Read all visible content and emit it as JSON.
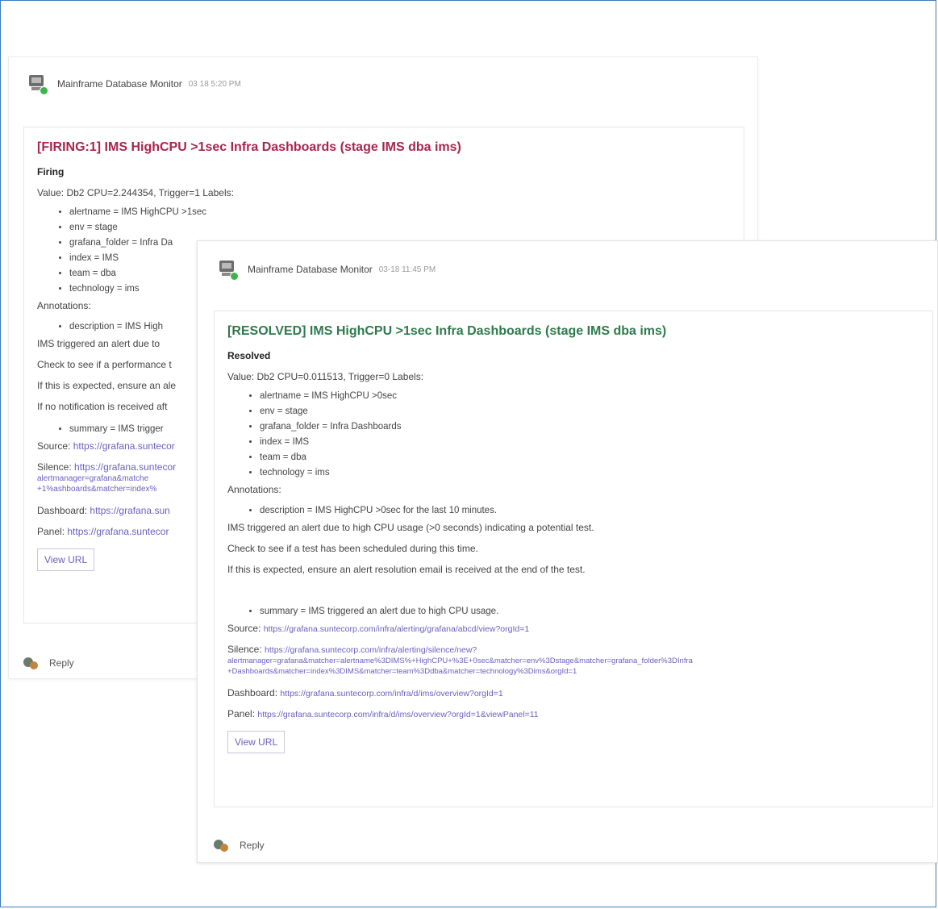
{
  "back_card": {
    "sender": "Mainframe Database Monitor",
    "time": "03 18 5:20 PM",
    "title": "[FIRING:1] IMS HighCPU >1sec Infra Dashboards (stage IMS dba ims)",
    "status": "Firing",
    "value_line": "Value: Db2 CPU=2.244354, Trigger=1 Labels:",
    "labels": [
      "alertname = IMS   HighCPU >1sec",
      "env = stage",
      "grafana_folder = Infra Da",
      "index = IMS",
      "team = dba",
      "technology = ims"
    ],
    "annotations_label": "Annotations:",
    "description": "description = IMS   High",
    "ims_line": "IMS   triggered an alert due to",
    "check_line": "Check to see if a performance t",
    "expected_line": "If this is expected, ensure an ale",
    "notification_line": "If no notification is received aft",
    "summary": "summary = IMS   trigger",
    "source_label": "Source:",
    "source_link": "https://grafana.suntecor",
    "silence_label": "Silence:",
    "silence_link_1": "https://grafana.suntecor",
    "silence_link_2": "alertmanager=grafana&matche",
    "silence_link_3": "+1%ashboards&matcher=index%",
    "dashboard_label": "Dashboard:",
    "dashboard_link": "https://grafana.sun",
    "panel_label": "Panel:",
    "panel_link": "https://grafana.suntecor",
    "view_url": "View URL",
    "reply": "Reply"
  },
  "front_card": {
    "sender": "Mainframe Database Monitor",
    "time": "03-18 11:45 PM",
    "title": "[RESOLVED] IMS HighCPU >1sec Infra Dashboards (stage IMS dba ims)",
    "status": "Resolved",
    "value_line": "Value: Db2 CPU=0.011513, Trigger=0 Labels:",
    "labels": [
      "alertname = IMS   HighCPU >0sec",
      "env = stage",
      "grafana_folder = Infra Dashboards",
      "index = IMS",
      "team = dba",
      "technology = ims"
    ],
    "annotations_label": "Annotations:",
    "description": "description = IMS   HighCPU >0sec for the last 10 minutes.",
    "ims_line": "IMS   triggered an alert due to high CPU usage (>0 seconds) indicating a potential test.",
    "check_line": "Check to see if a test has been scheduled during this time.",
    "expected_line": "If this is expected, ensure an alert resolution email is received at the end of the test.",
    "summary": "summary = IMS   triggered an alert due to high CPU usage.",
    "source_label": "Source:",
    "source_link": "https://grafana.suntecorp.com/infra/alerting/grafana/abcd/view?orgId=1",
    "silence_label": "Silence:",
    "silence_link_1": "https://grafana.suntecorp.com/infra/alerting/silence/new?",
    "silence_link_2": "alertmanager=grafana&matcher=alertname%3DIMS%+HighCPU+%3E+0sec&matcher=env%3Dstage&matcher=grafana_folder%3DInfra",
    "silence_link_3": "+Dashboards&matcher=index%3DIMS&matcher=team%3Ddba&matcher=technology%3Dims&orgId=1",
    "dashboard_label": "Dashboard:",
    "dashboard_link": "https://grafana.suntecorp.com/infra/d/ims/overview?orgId=1",
    "panel_label": "Panel:",
    "panel_link": "https://grafana.suntecorp.com/infra/d/ims/overview?orgId=1&viewPanel=11",
    "view_url": "View URL",
    "reply": "Reply"
  },
  "colors": {
    "firing": "#a8264d",
    "resolved": "#2f7a4d",
    "link": "#6a5fbf",
    "frame": "#3a7bbf"
  },
  "icons": [
    "monitor-avatar-icon",
    "online-status-icon",
    "reply-avatar-icon"
  ]
}
